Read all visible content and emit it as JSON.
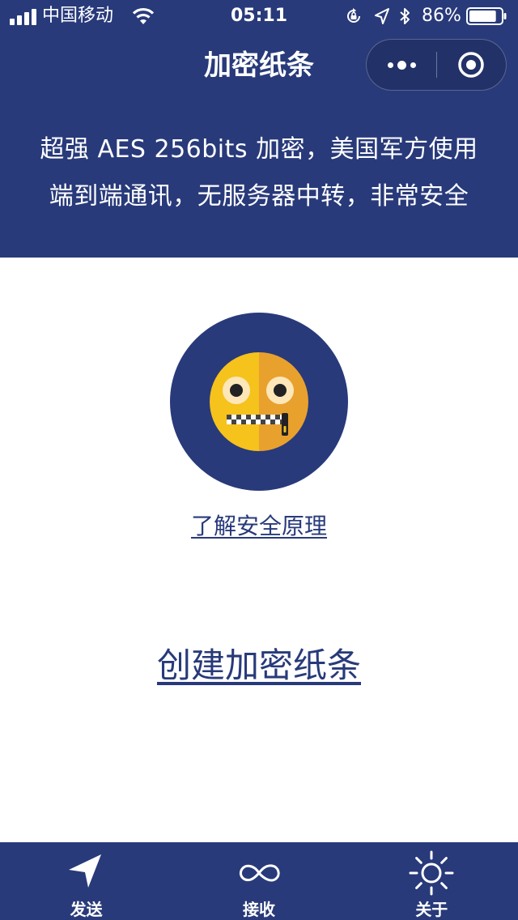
{
  "status_bar": {
    "carrier": "中国移动",
    "time": "05:11",
    "battery_percent": "86%",
    "battery_level": 0.86
  },
  "nav": {
    "title": "加密纸条"
  },
  "intro": {
    "line1": "超强 AES 256bits 加密，美国军方使用",
    "line2": "端到端通讯，无服务器中转，非常安全"
  },
  "main": {
    "badge_icon": "zipper-mouth-face-icon",
    "learn_link": "了解安全原理",
    "create_link": "创建加密纸条"
  },
  "tabbar": {
    "items": [
      {
        "label": "发送",
        "icon": "send-arrow-icon"
      },
      {
        "label": "接收",
        "icon": "infinity-icon"
      },
      {
        "label": "关于",
        "icon": "sun-icon"
      }
    ]
  },
  "colors": {
    "primary": "#283a7a",
    "emoji_yellow": "#f6c21c",
    "emoji_shade": "#e9a12d"
  }
}
